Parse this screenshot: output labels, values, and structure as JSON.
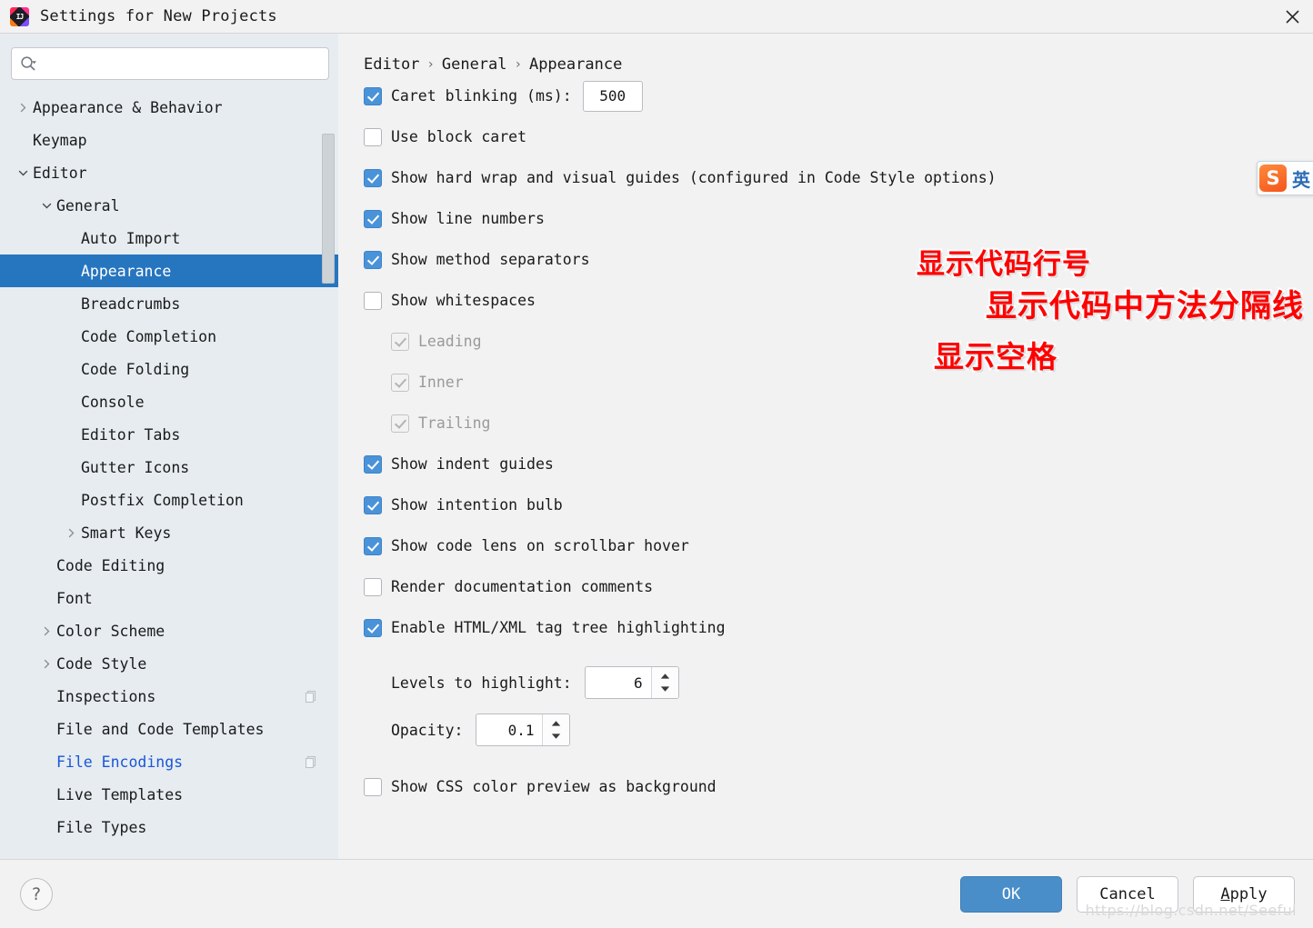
{
  "window": {
    "title": "Settings for New Projects",
    "app_icon": "intellij-idea-icon",
    "close_icon": "close-icon"
  },
  "search": {
    "value": "",
    "placeholder": "",
    "icon": "search-icon"
  },
  "sidebar": {
    "items": [
      {
        "label": "Appearance & Behavior",
        "level": 0,
        "arrow": "collapsed",
        "selected": false,
        "modified": false,
        "copy_icon": false
      },
      {
        "label": "Keymap",
        "level": 0,
        "arrow": "none",
        "selected": false,
        "modified": false,
        "copy_icon": false
      },
      {
        "label": "Editor",
        "level": 0,
        "arrow": "expanded",
        "selected": false,
        "modified": false,
        "copy_icon": false
      },
      {
        "label": "General",
        "level": 1,
        "arrow": "expanded",
        "selected": false,
        "modified": false,
        "copy_icon": false
      },
      {
        "label": "Auto Import",
        "level": 2,
        "arrow": "none",
        "selected": false,
        "modified": false,
        "copy_icon": false
      },
      {
        "label": "Appearance",
        "level": 2,
        "arrow": "none",
        "selected": true,
        "modified": false,
        "copy_icon": false
      },
      {
        "label": "Breadcrumbs",
        "level": 2,
        "arrow": "none",
        "selected": false,
        "modified": false,
        "copy_icon": false
      },
      {
        "label": "Code Completion",
        "level": 2,
        "arrow": "none",
        "selected": false,
        "modified": false,
        "copy_icon": false
      },
      {
        "label": "Code Folding",
        "level": 2,
        "arrow": "none",
        "selected": false,
        "modified": false,
        "copy_icon": false
      },
      {
        "label": "Console",
        "level": 2,
        "arrow": "none",
        "selected": false,
        "modified": false,
        "copy_icon": false
      },
      {
        "label": "Editor Tabs",
        "level": 2,
        "arrow": "none",
        "selected": false,
        "modified": false,
        "copy_icon": false
      },
      {
        "label": "Gutter Icons",
        "level": 2,
        "arrow": "none",
        "selected": false,
        "modified": false,
        "copy_icon": false
      },
      {
        "label": "Postfix Completion",
        "level": 2,
        "arrow": "none",
        "selected": false,
        "modified": false,
        "copy_icon": false
      },
      {
        "label": "Smart Keys",
        "level": 2,
        "arrow": "collapsed",
        "selected": false,
        "modified": false,
        "copy_icon": false
      },
      {
        "label": "Code Editing",
        "level": 1,
        "arrow": "none",
        "selected": false,
        "modified": false,
        "copy_icon": false
      },
      {
        "label": "Font",
        "level": 1,
        "arrow": "none",
        "selected": false,
        "modified": false,
        "copy_icon": false
      },
      {
        "label": "Color Scheme",
        "level": 1,
        "arrow": "collapsed",
        "selected": false,
        "modified": false,
        "copy_icon": false
      },
      {
        "label": "Code Style",
        "level": 1,
        "arrow": "collapsed",
        "selected": false,
        "modified": false,
        "copy_icon": false
      },
      {
        "label": "Inspections",
        "level": 1,
        "arrow": "none",
        "selected": false,
        "modified": false,
        "copy_icon": true
      },
      {
        "label": "File and Code Templates",
        "level": 1,
        "arrow": "none",
        "selected": false,
        "modified": false,
        "copy_icon": false
      },
      {
        "label": "File Encodings",
        "level": 1,
        "arrow": "none",
        "selected": false,
        "modified": true,
        "copy_icon": true
      },
      {
        "label": "Live Templates",
        "level": 1,
        "arrow": "none",
        "selected": false,
        "modified": false,
        "copy_icon": false
      },
      {
        "label": "File Types",
        "level": 1,
        "arrow": "none",
        "selected": false,
        "modified": false,
        "copy_icon": false
      }
    ]
  },
  "breadcrumb": {
    "parts": [
      "Editor",
      "General",
      "Appearance"
    ],
    "separator": "›"
  },
  "settings": {
    "caret_blinking": {
      "label": "Caret blinking (ms):",
      "checked": true,
      "value": "500"
    },
    "options": [
      {
        "label": "Use block caret",
        "checked": false,
        "disabled": false,
        "sub": false
      },
      {
        "label": "Show hard wrap and visual guides (configured in Code Style options)",
        "checked": true,
        "disabled": false,
        "sub": false
      },
      {
        "label": "Show line numbers",
        "checked": true,
        "disabled": false,
        "sub": false
      },
      {
        "label": "Show method separators",
        "checked": true,
        "disabled": false,
        "sub": false
      },
      {
        "label": "Show whitespaces",
        "checked": false,
        "disabled": false,
        "sub": false
      },
      {
        "label": "Leading",
        "checked": true,
        "disabled": true,
        "sub": true
      },
      {
        "label": "Inner",
        "checked": true,
        "disabled": true,
        "sub": true
      },
      {
        "label": "Trailing",
        "checked": true,
        "disabled": true,
        "sub": true
      },
      {
        "label": "Show indent guides",
        "checked": true,
        "disabled": false,
        "sub": false
      },
      {
        "label": "Show intention bulb",
        "checked": true,
        "disabled": false,
        "sub": false
      },
      {
        "label": "Show code lens on scrollbar hover",
        "checked": true,
        "disabled": false,
        "sub": false
      },
      {
        "label": "Render documentation comments",
        "checked": false,
        "disabled": false,
        "sub": false
      },
      {
        "label": "Enable HTML/XML tag tree highlighting",
        "checked": true,
        "disabled": false,
        "sub": false
      }
    ],
    "spinners": [
      {
        "label": "Levels to highlight:",
        "value": "6"
      },
      {
        "label": "Opacity:",
        "value": "0.1"
      }
    ],
    "css_preview": {
      "label": "Show CSS color preview as background",
      "checked": false
    }
  },
  "annotations": [
    {
      "text": "显示代码行号",
      "color": "#ff0000"
    },
    {
      "text": "显示代码中方法分隔线",
      "color": "#ff0000"
    },
    {
      "text": "显示空格",
      "color": "#ff0000"
    }
  ],
  "ime": {
    "logo_text": "S",
    "mode": "英",
    "logo_color": "#f4561c"
  },
  "footer": {
    "help_label": "?",
    "ok_label": "OK",
    "cancel_label": "Cancel",
    "apply_mnemonic": "A",
    "apply_rest": "pply"
  },
  "watermark": "https://blog.csdn.net/Seeful",
  "colors": {
    "accent": "#2675bf",
    "primary_button": "#4a8ec9",
    "checkbox_on": "#4a93d9",
    "sidebar_bg": "#e6ecf0",
    "panel_bg": "#f2f2f2",
    "modified_link": "#1a57d6",
    "annotation_red": "#ff0000"
  }
}
